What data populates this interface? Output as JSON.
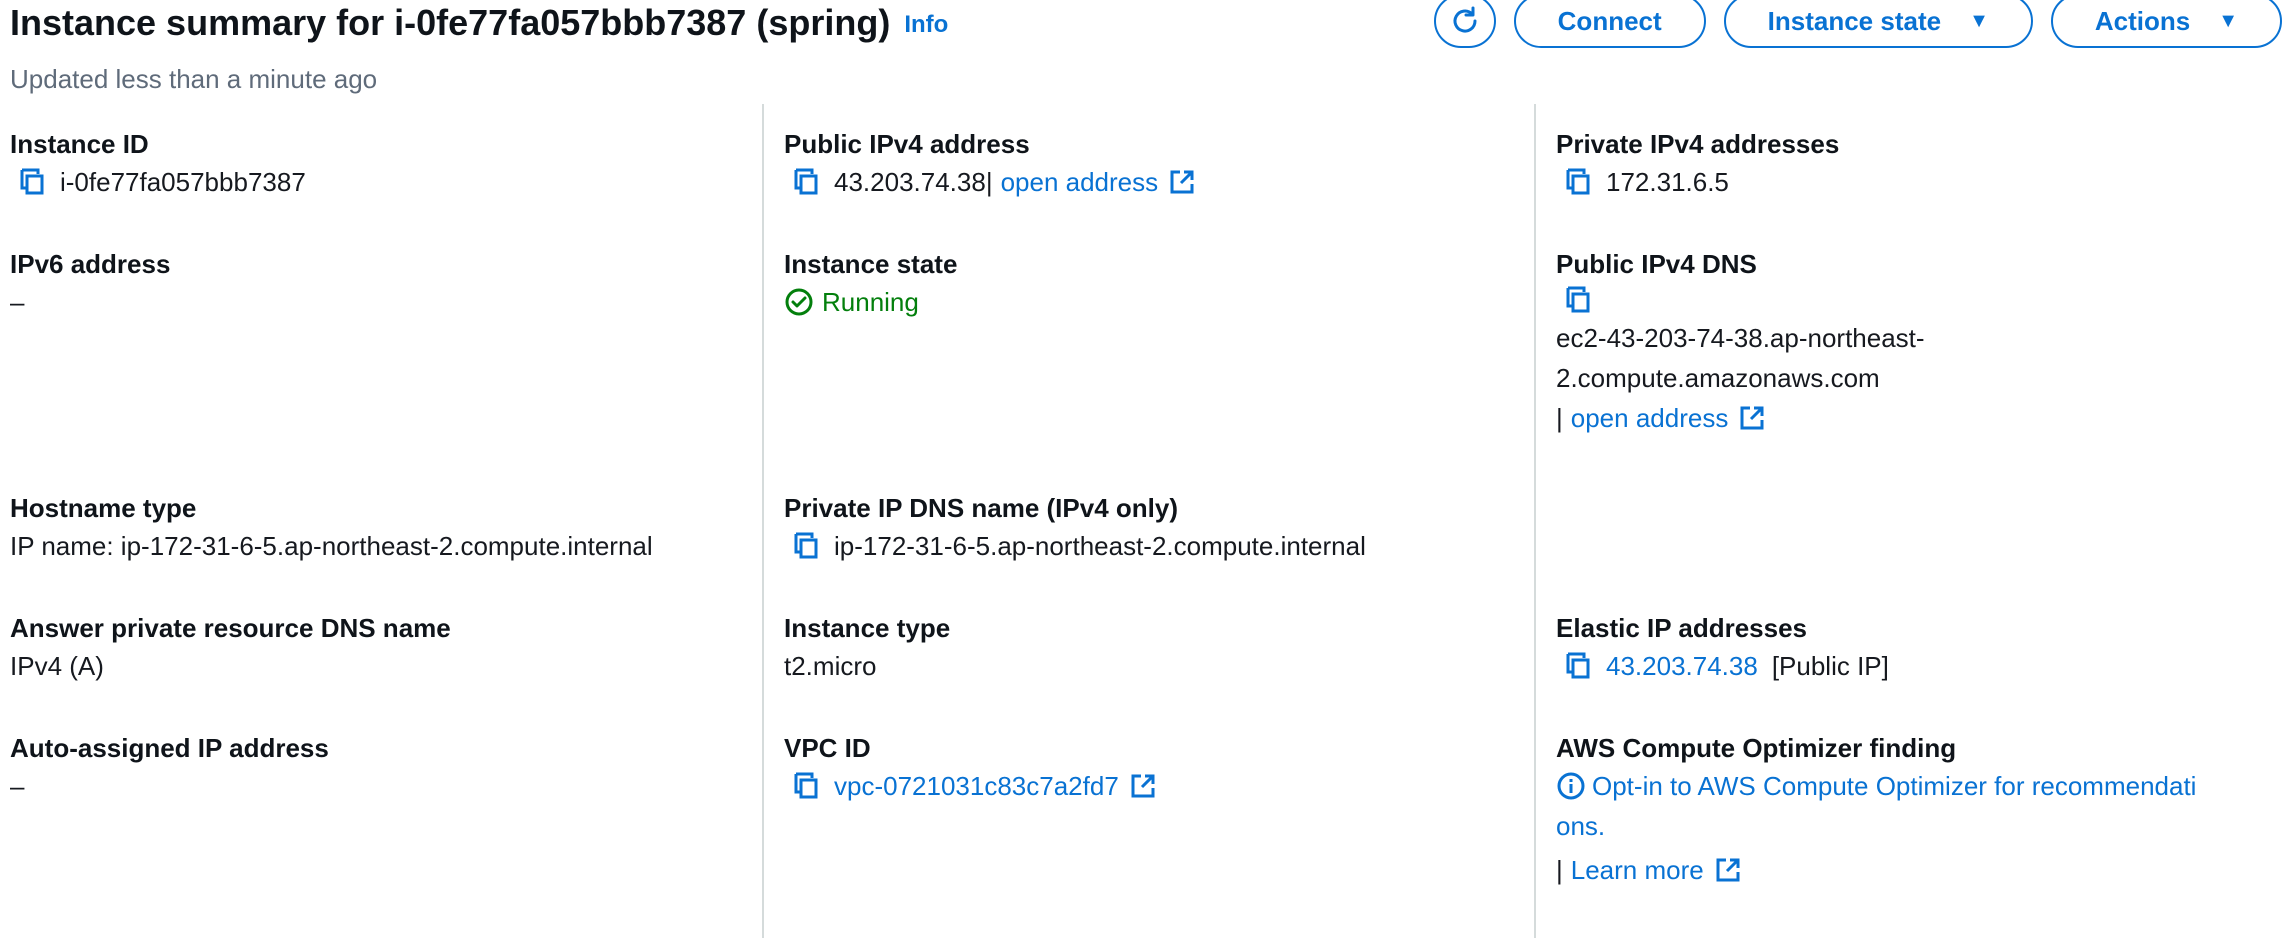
{
  "header": {
    "title": "Instance summary for i-0fe77fa057bbb7387 (spring)",
    "info_label": "Info",
    "subtitle": "Updated less than a minute ago",
    "buttons": {
      "refresh_icon": "refresh-icon",
      "connect": "Connect",
      "instance_state": "Instance state",
      "actions": "Actions"
    }
  },
  "col1": {
    "instance_id": {
      "label": "Instance ID",
      "value": "i-0fe77fa057bbb7387"
    },
    "ipv6": {
      "label": "IPv6 address",
      "value": "–"
    },
    "hostname_type": {
      "label": "Hostname type",
      "value": "IP name: ip-172-31-6-5.ap-northeast-2.compute.internal"
    },
    "answer_dns": {
      "label": "Answer private resource DNS name",
      "value": "IPv4 (A)"
    },
    "auto_ip": {
      "label": "Auto-assigned IP address",
      "value": "–"
    }
  },
  "col2": {
    "public_ipv4": {
      "label": "Public IPv4 address",
      "value": "43.203.74.38",
      "separator": " |",
      "link": "open address"
    },
    "instance_state": {
      "label": "Instance state",
      "value": "Running"
    },
    "private_dns": {
      "label": "Private IP DNS name (IPv4 only)",
      "value": "ip-172-31-6-5.ap-northeast-2.compute.internal"
    },
    "instance_type": {
      "label": "Instance type",
      "value": "t2.micro"
    },
    "vpc_id": {
      "label": "VPC ID",
      "value": "vpc-0721031c83c7a2fd7"
    }
  },
  "col3": {
    "private_ipv4": {
      "label": "Private IPv4 addresses",
      "value": "172.31.6.5"
    },
    "public_dns": {
      "label": "Public IPv4 DNS",
      "value_line1": "ec2-43-203-74-38.ap-northeast-",
      "value_line2": "2.compute.amazonaws.com",
      "separator": "|",
      "link": "open address"
    },
    "elastic_ip": {
      "label": "Elastic IP addresses",
      "value": "43.203.74.38",
      "suffix": "[Public IP]"
    },
    "optimizer": {
      "label": "AWS Compute Optimizer finding",
      "link_line1": "Opt-in to AWS Compute Optimizer for recommendati",
      "link_line2": "ons.",
      "separator": "|",
      "learn_more": "Learn more"
    }
  },
  "colors": {
    "link": "#0972d3",
    "running": "#037f0c",
    "divider": "#d5dbdb",
    "muted": "#5f6b7a"
  }
}
